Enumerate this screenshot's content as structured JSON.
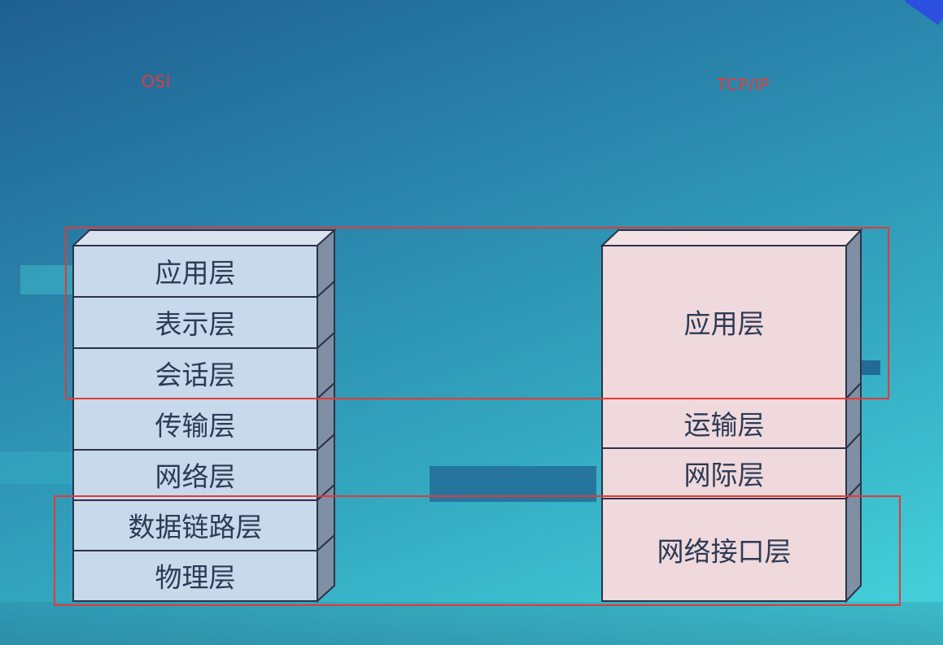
{
  "labels": {
    "osi": "OSI",
    "tcpip": "TCP/IP"
  },
  "osi_layers": [
    "应用层",
    "表示层",
    "会话层",
    "传输层",
    "网络层",
    "数据链路层",
    "物理层"
  ],
  "tcpip_layers": [
    "应用层",
    "运输层",
    "网际层",
    "网络接口层"
  ],
  "colors": {
    "osi_fill": "#c9d9ec",
    "tcpip_fill": "#efd9dc",
    "side_fill": "#7f8fa4",
    "top_fill": "#d8e3ef",
    "outline": "#2c3347",
    "highlight": "#e53935"
  }
}
